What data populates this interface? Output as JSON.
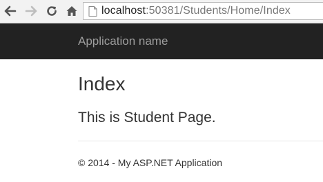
{
  "browser": {
    "url_host": "localhost",
    "url_path": ":50381/Students/Home/Index",
    "icons": {
      "back": "back-arrow-icon",
      "forward": "forward-arrow-icon",
      "reload": "reload-icon",
      "home": "home-icon",
      "page": "page-icon"
    }
  },
  "navbar": {
    "brand": "Application name",
    "background": "#222222",
    "brand_color": "#9d9d9d"
  },
  "main": {
    "title": "Index",
    "text": "This is Student Page."
  },
  "footer": {
    "text": "© 2014 - My ASP.NET Application"
  }
}
